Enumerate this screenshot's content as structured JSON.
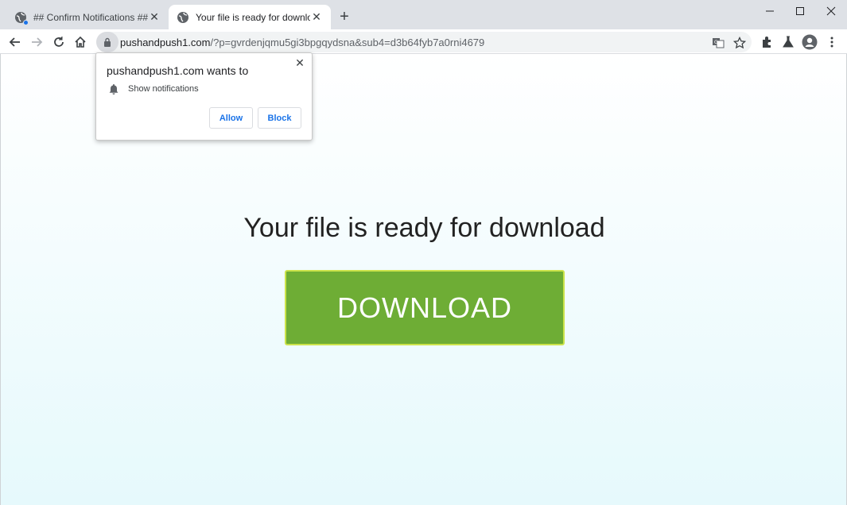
{
  "tabs": [
    {
      "title": "## Confirm Notifications ##",
      "icon": "globe-icon",
      "has_badge": true
    },
    {
      "title": "Your file is ready for download",
      "icon": "globe-icon",
      "active": true
    }
  ],
  "omnibox": {
    "domain": "pushandpush1.com",
    "path": "/?p=gvrdenjqmu5gi3bpgqydsna&sub4=d3b64fyb7a0rni4679"
  },
  "popup": {
    "title": "pushandpush1.com wants to",
    "permission": "Show notifications",
    "allow_label": "Allow",
    "block_label": "Block"
  },
  "page": {
    "headline": "Your file is ready for download",
    "download_label": "DOWNLOAD"
  },
  "colors": {
    "download_bg": "#6ead35",
    "download_border": "#cbe34a",
    "link_blue": "#1a73e8"
  }
}
